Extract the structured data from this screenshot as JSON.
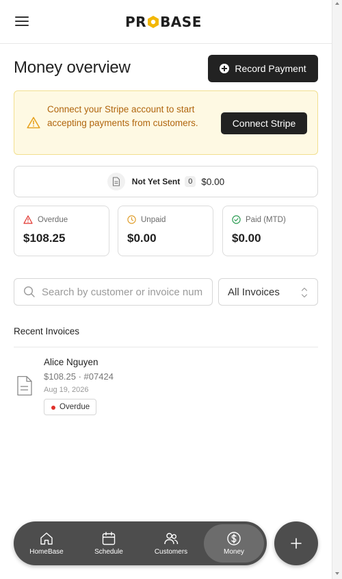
{
  "header": {
    "logo_text_left": "PR",
    "logo_text_right": "BASE"
  },
  "page": {
    "title": "Money overview",
    "record_payment_label": "Record Payment"
  },
  "banner": {
    "message": "Connect your Stripe account to start accepting payments from customers.",
    "button_label": "Connect Stripe",
    "accent_color": "#b0650d"
  },
  "not_yet_sent": {
    "label": "Not Yet Sent",
    "count": "0",
    "amount": "$0.00"
  },
  "stats": [
    {
      "label": "Overdue",
      "value": "$108.25",
      "icon": "alert-triangle-icon",
      "color": "#e0312b"
    },
    {
      "label": "Unpaid",
      "value": "$0.00",
      "icon": "clock-icon",
      "color": "#e0a030"
    },
    {
      "label": "Paid (MTD)",
      "value": "$0.00",
      "icon": "check-circle-icon",
      "color": "#2e9d55"
    }
  ],
  "search": {
    "placeholder": "Search by customer or invoice number",
    "value": ""
  },
  "filter": {
    "selected": "All Invoices"
  },
  "recent": {
    "title": "Recent Invoices",
    "invoices": [
      {
        "customer": "Alice Nguyen",
        "meta": "$108.25 · #07424",
        "date": "Aug 19, 2026",
        "status": "Overdue"
      }
    ]
  },
  "nav": {
    "items": [
      {
        "label": "HomeBase",
        "icon": "home-icon"
      },
      {
        "label": "Schedule",
        "icon": "calendar-icon"
      },
      {
        "label": "Customers",
        "icon": "users-icon"
      },
      {
        "label": "Money",
        "icon": "dollar-circle-icon"
      }
    ],
    "active": "Money"
  }
}
